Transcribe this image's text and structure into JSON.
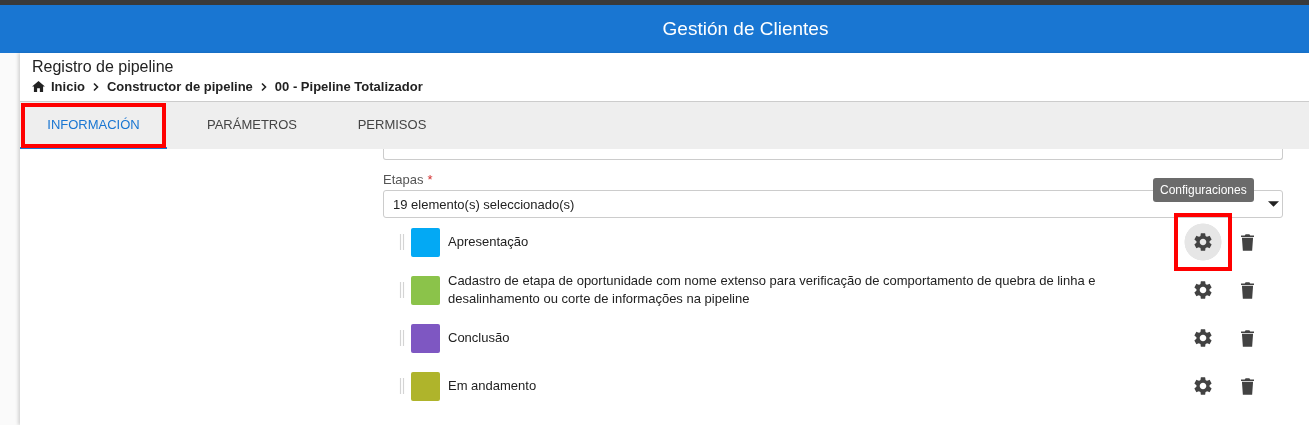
{
  "header": {
    "title": "Gestión de Clientes"
  },
  "page": {
    "title": "Registro de pipeline",
    "breadcrumb": [
      {
        "label": "Inicio",
        "kind": "home"
      },
      {
        "label": "Constructor de pipeline",
        "kind": "link"
      },
      {
        "label": "00 - Pipeline Totalizador",
        "kind": "link"
      }
    ]
  },
  "tabs": [
    {
      "label": "INFORMACIÓN",
      "selected": true,
      "annotated": true
    },
    {
      "label": "PARÁMETROS",
      "selected": false,
      "annotated": false
    },
    {
      "label": "PERMISOS",
      "selected": false,
      "annotated": false
    }
  ],
  "etapas": {
    "label": "Etapas",
    "required_mark": "*",
    "value": "19 elemento(s) seleccionado(s)",
    "tooltip": "Configuraciones",
    "items": [
      {
        "name": "Apresentação",
        "color": "#03a9f4",
        "settings_hovered": true,
        "settings_annotated": true
      },
      {
        "name": "Cadastro de etapa de oportunidade com nome extenso para verificação de comportamento de quebra de linha e desalinhamento ou corte de informações na pipeline",
        "color": "#8bc34a",
        "settings_hovered": false,
        "settings_annotated": false
      },
      {
        "name": "Conclusão",
        "color": "#7e57c2",
        "settings_hovered": false,
        "settings_annotated": false
      },
      {
        "name": "Em andamento",
        "color": "#afb42b",
        "settings_hovered": false,
        "settings_annotated": false
      }
    ]
  }
}
